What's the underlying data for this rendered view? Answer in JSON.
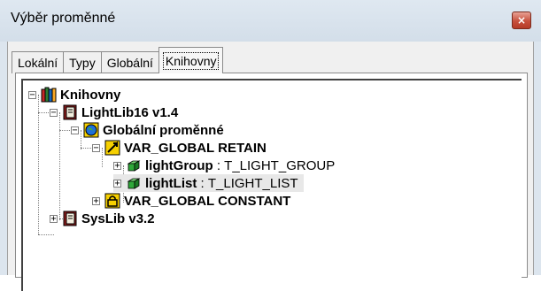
{
  "window": {
    "title": "Výběr proměnné",
    "close_glyph": "×"
  },
  "tabs": [
    {
      "label": "Lokální",
      "active": false
    },
    {
      "label": "Typy",
      "active": false
    },
    {
      "label": "Globální",
      "active": false
    },
    {
      "label": "Knihovny",
      "active": true
    }
  ],
  "tree": {
    "root": {
      "label": "Knihovny",
      "expander": "−",
      "icon": "books-icon"
    },
    "lib1": {
      "label": "LightLib16 v1.4",
      "expander": "−",
      "icon": "book-icon"
    },
    "globals": {
      "label": "Globální proměnné",
      "expander": "−",
      "icon": "globe-icon"
    },
    "retain": {
      "label": "VAR_GLOBAL RETAIN",
      "expander": "−",
      "icon": "retain-icon"
    },
    "var1": {
      "name": "lightGroup",
      "sep": " : ",
      "type": "T_LIGHT_GROUP",
      "expander": "+",
      "icon": "variable-icon"
    },
    "var2": {
      "name": "lightList",
      "sep": " : ",
      "type": "T_LIGHT_LIST",
      "expander": "+",
      "icon": "variable-icon",
      "selected": true
    },
    "constant": {
      "label": "VAR_GLOBAL CONSTANT",
      "expander": "+",
      "icon": "lock-icon"
    },
    "lib2": {
      "label": "SysLib v3.2",
      "expander": "+",
      "icon": "book-icon"
    }
  },
  "colors": {
    "titlebar": "#d8e2ec",
    "close_button": "#c7503d",
    "selection": "#e8e8e8"
  }
}
